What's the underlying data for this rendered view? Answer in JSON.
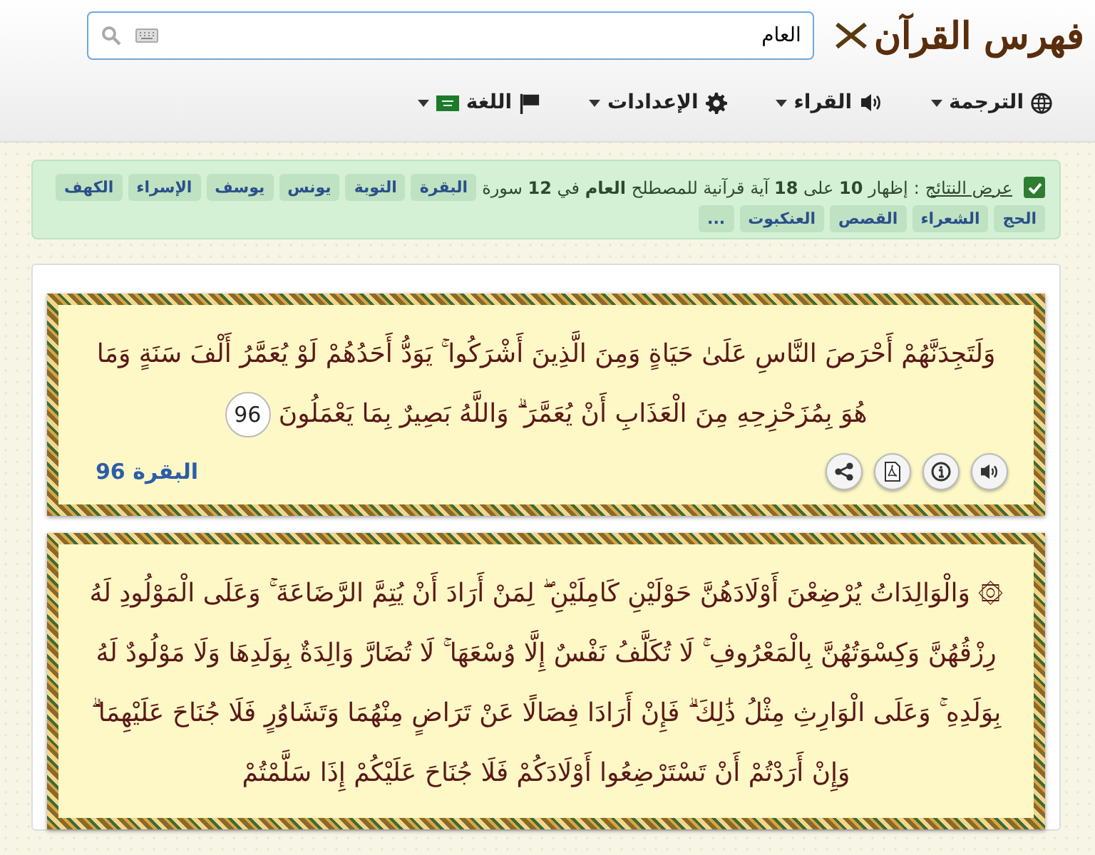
{
  "header": {
    "logo": "فهرس القرآن",
    "search": {
      "value": "العام"
    }
  },
  "nav": [
    {
      "kind": "translation",
      "label": "الترجمة"
    },
    {
      "kind": "reciters",
      "label": "القراء"
    },
    {
      "kind": "settings",
      "label": "الإعدادات"
    },
    {
      "kind": "language",
      "label": "اللغة"
    }
  ],
  "summary": {
    "checked": true,
    "link": "عرض النتائج",
    "separator": ":",
    "text": "إظهار **10** على **18** آية قرآنية للمصطلح **العام** في **12** سورة",
    "surahs": [
      "البقرة",
      "التوبة",
      "يونس",
      "يوسف",
      "الإسراء",
      "الكهف",
      "الحج",
      "الشعراء",
      "القصص",
      "العنكبوت",
      "..."
    ]
  },
  "verses": [
    {
      "text": "وَلَتَجِدَنَّهُمْ أَحْرَصَ النَّاسِ عَلَىٰ حَيَاةٍ وَمِنَ الَّذِينَ أَشْرَكُوا ۚ يَوَدُّ أَحَدُهُمْ لَوْ يُعَمَّرُ أَلْفَ سَنَةٍ وَمَا هُوَ بِمُزَحْزِحِهِ مِنَ الْعَذَابِ أَنْ يُعَمَّرَ ۗ وَاللَّهُ بَصِيرٌ بِمَا يَعْمَلُونَ",
      "number": "96",
      "reference": "البقرة 96"
    },
    {
      "mark": "۞",
      "text": "وَالْوَالِدَاتُ يُرْضِعْنَ أَوْلَادَهُنَّ حَوْلَيْنِ كَامِلَيْنِ ۖ لِمَنْ أَرَادَ أَنْ يُتِمَّ الرَّضَاعَةَ ۚ وَعَلَى الْمَوْلُودِ لَهُ رِزْقُهُنَّ وَكِسْوَتُهُنَّ بِالْمَعْرُوفِ ۚ لَا تُكَلَّفُ نَفْسٌ إِلَّا وُسْعَهَا ۚ لَا تُضَارَّ وَالِدَةٌ بِوَلَدِهَا وَلَا مَوْلُودٌ لَهُ بِوَلَدِهِ ۚ وَعَلَى الْوَارِثِ مِثْلُ ذَٰلِكَ ۗ فَإِنْ أَرَادَا فِصَالًا عَنْ تَرَاضٍ مِنْهُمَا وَتَشَاوُرٍ فَلَا جُنَاحَ عَلَيْهِمَا ۗ وَإِنْ أَرَدْتُمْ أَنْ تَسْتَرْضِعُوا أَوْلَادَكُمْ فَلَا جُنَاحَ عَلَيْكُمْ إِذَا سَلَّمْتُمْ"
    }
  ]
}
